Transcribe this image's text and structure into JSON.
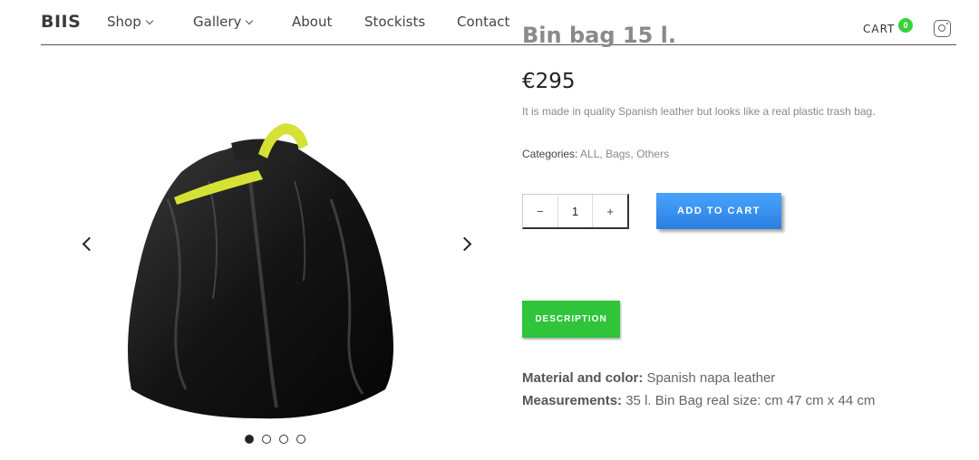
{
  "brand": {
    "logo": "BIIS"
  },
  "nav": {
    "items": [
      {
        "label": "Shop",
        "has_dropdown": true
      },
      {
        "label": "Gallery",
        "has_dropdown": true
      },
      {
        "label": "About",
        "has_dropdown": false
      },
      {
        "label": "Stockists",
        "has_dropdown": false
      },
      {
        "label": "Contact",
        "has_dropdown": false
      }
    ]
  },
  "header": {
    "cart_label": "CART",
    "cart_count": "0",
    "social_icon": "instagram-icon"
  },
  "product": {
    "title": "Bin bag 15 l.",
    "price": "€295",
    "description": "It is made in quality Spanish leather but looks like a real plastic trash bag.",
    "categories_label": "Categories:",
    "categories": "ALL, Bags, Others",
    "quantity": "1",
    "add_to_cart": "ADD TO CART"
  },
  "gallery": {
    "slide_count": 4,
    "active_index": 0
  },
  "tabs": {
    "description": "DESCRIPTION"
  },
  "details": {
    "material_label": "Material and color:",
    "material_value": "Spanish napa leather",
    "measure_label": "Measurements:",
    "measure_value": "35 l. Bin Bag real size: cm 47 cm x 44 cm"
  },
  "colors": {
    "cart_badge": "#3ad23a",
    "add_button": "#2a8cf0",
    "tab_active": "#2fc43a"
  }
}
